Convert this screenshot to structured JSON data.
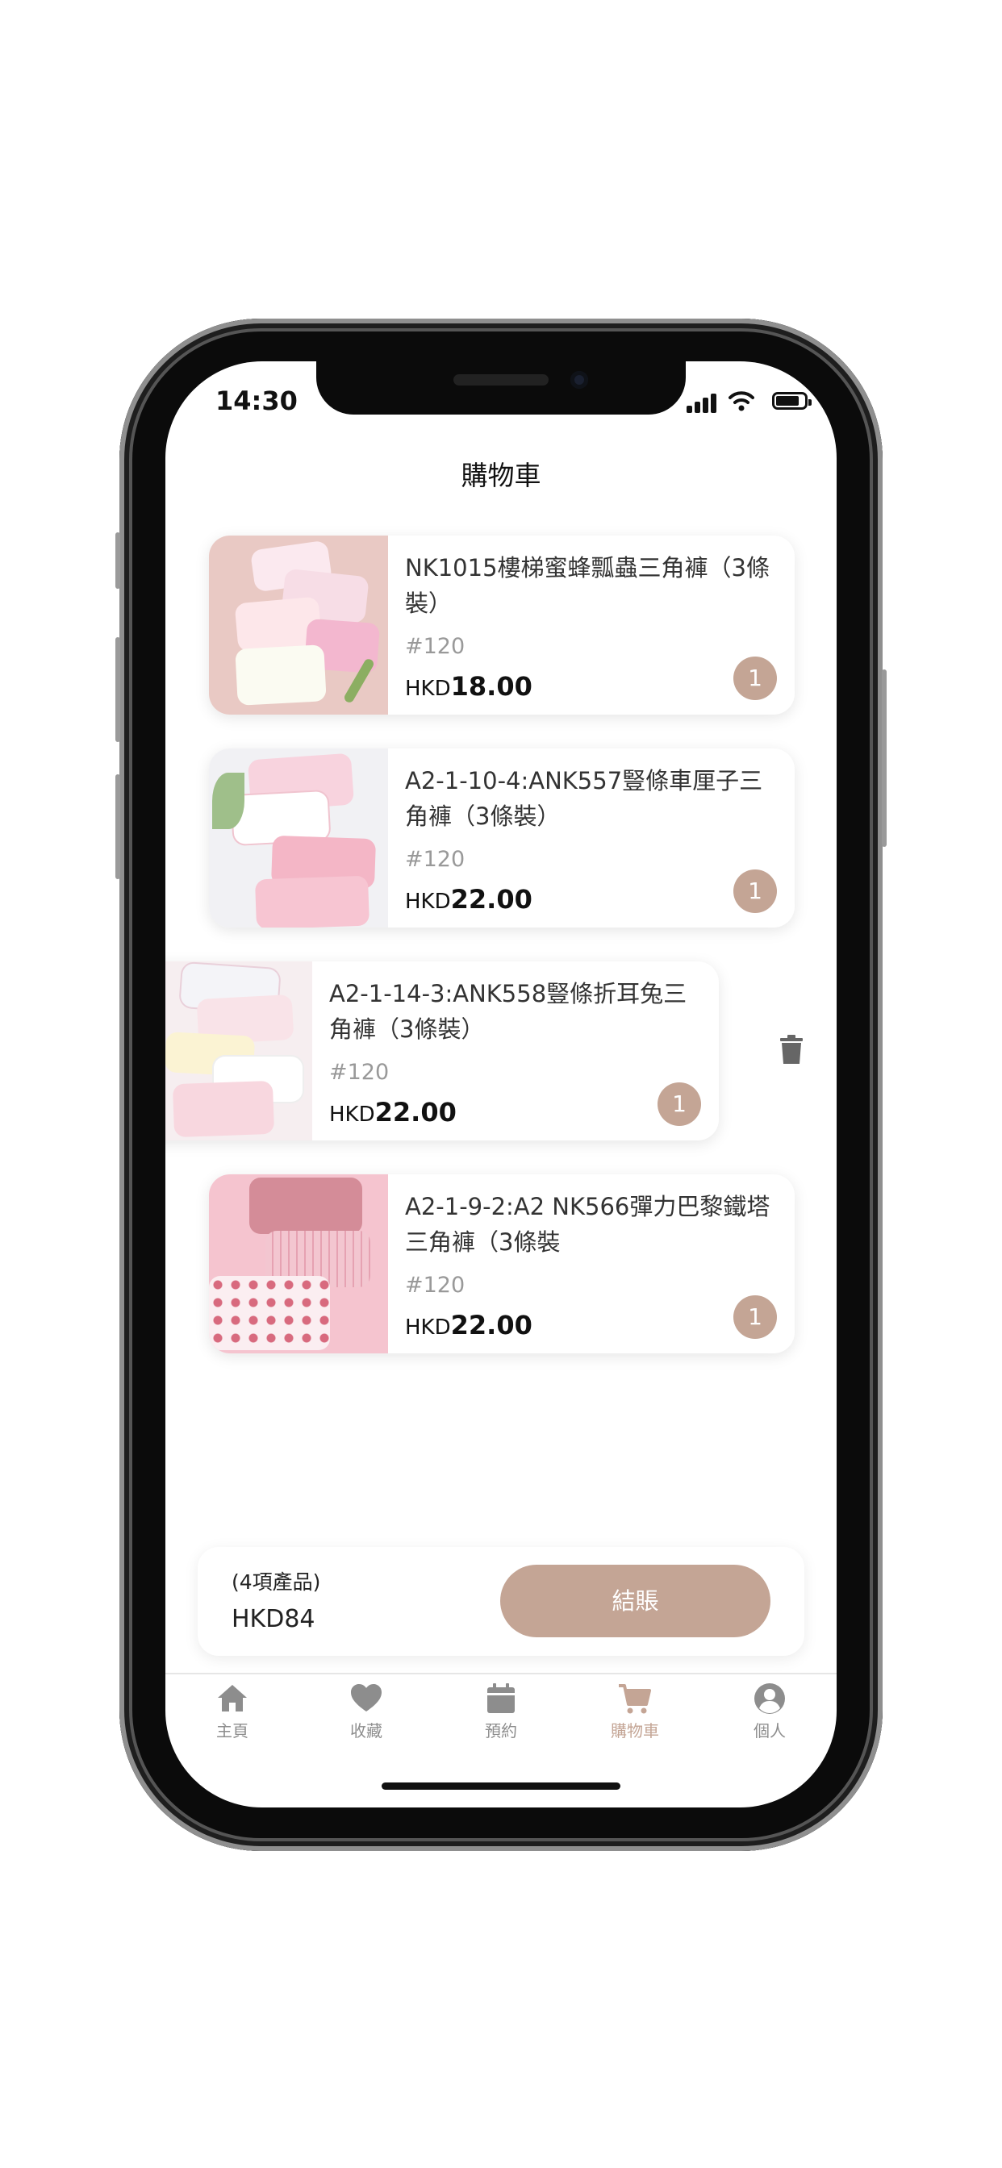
{
  "status_bar": {
    "time": "14:30"
  },
  "header": {
    "title": "購物車"
  },
  "cart_items": [
    {
      "name": "NK1015樓梯蜜蜂瓢蟲三角褲（3條裝）",
      "sku": "#120",
      "currency": "HKD",
      "price": "18.00",
      "qty": "1"
    },
    {
      "name": "A2-1-10-4:ANK557豎條車厘子三角褲（3條裝）",
      "sku": "#120",
      "currency": "HKD",
      "price": "22.00",
      "qty": "1"
    },
    {
      "name": "A2-1-14-3:ANK558豎條折耳兔三角褲（3條裝）",
      "sku": "#120",
      "currency": "HKD",
      "price": "22.00",
      "qty": "1"
    },
    {
      "name": "A2-1-9-2:A2 NK566彈力巴黎鐵塔三角褲（3條裝",
      "sku": "#120",
      "currency": "HKD",
      "price": "22.00",
      "qty": "1"
    }
  ],
  "summary": {
    "count_label": "(4項產品)",
    "total": "HKD84",
    "checkout_label": "結賬"
  },
  "tab_bar": {
    "items": [
      {
        "label": "主頁",
        "icon": "home-icon"
      },
      {
        "label": "收藏",
        "icon": "heart-icon"
      },
      {
        "label": "預約",
        "icon": "calendar-icon"
      },
      {
        "label": "購物車",
        "icon": "cart-icon",
        "active": true
      },
      {
        "label": "個人",
        "icon": "user-icon"
      }
    ]
  },
  "colors": {
    "accent": "#c4a595",
    "tab_inactive": "#8d8d8d"
  }
}
